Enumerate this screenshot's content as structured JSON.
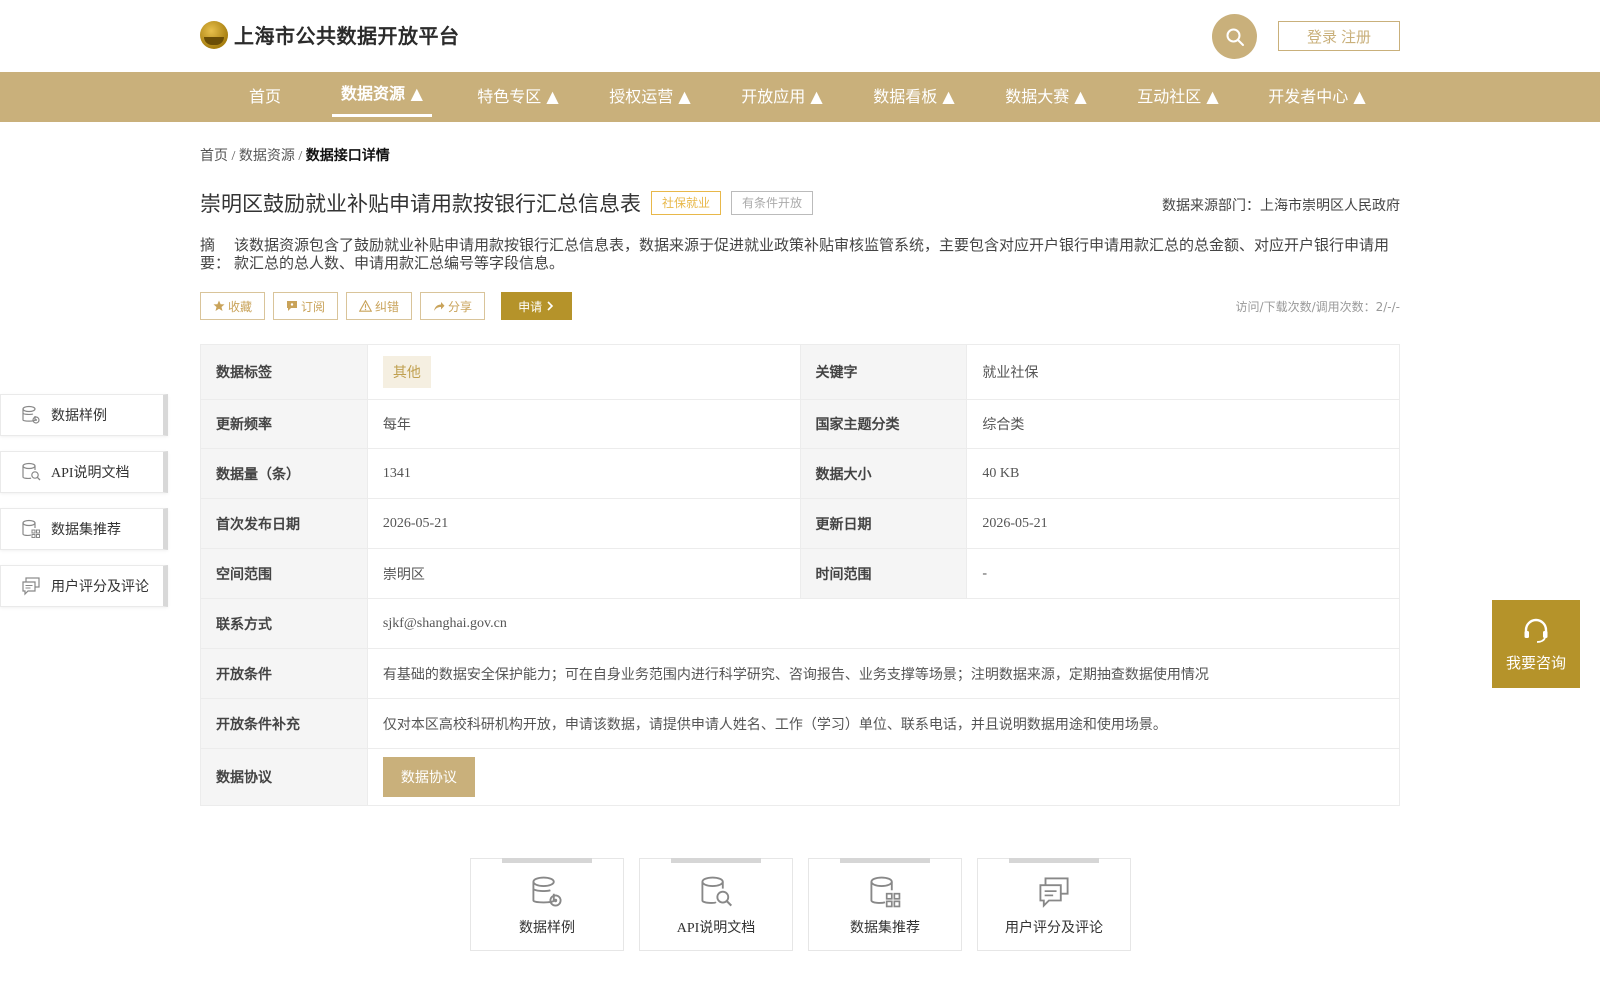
{
  "header": {
    "logo_text": "上海市公共数据开放平台",
    "login_label": "登录",
    "register_label": "注册"
  },
  "nav": {
    "items": [
      {
        "label": "首页"
      },
      {
        "label": "数据资源 ▲"
      },
      {
        "label": "特色专区 ▲"
      },
      {
        "label": "授权运营 ▲"
      },
      {
        "label": "开放应用 ▲"
      },
      {
        "label": "数据看板 ▲"
      },
      {
        "label": "数据大赛 ▲"
      },
      {
        "label": "互动社区 ▲"
      },
      {
        "label": "开发者中心 ▲"
      }
    ],
    "active_index": 1
  },
  "breadcrumb": {
    "home": "首页",
    "sep1": "/",
    "section": "数据资源",
    "sep2": "/",
    "current": "数据接口详情"
  },
  "dataset": {
    "title": "崇明区鼓励就业补贴申请用款按银行汇总信息表",
    "tag_category": "社保就业",
    "tag_open": "有条件开放",
    "source": "数据来源部门：上海市崇明区人民政府",
    "abstract_label": "摘要：",
    "abstract_text": "该数据资源包含了鼓励就业补贴申请用款按银行汇总信息表，数据来源于促进就业政策补贴审核监管系统，主要包含对应开户银行申请用款汇总的总金额、对应开户银行申请用款汇总的总人数、申请用款汇总编号等字段信息。",
    "stats": "访问/下载次数/调用次数：2/-/-"
  },
  "actions": {
    "favorite": "收藏",
    "subscribe": "订阅",
    "report": "纠错",
    "share": "分享",
    "apply": "申请"
  },
  "info": {
    "tag_label": "数据标签",
    "tag_value": "其他",
    "keyword_label": "关键字",
    "keyword_value": "就业社保",
    "freq_label": "更新频率",
    "freq_value": "每年",
    "theme_label": "国家主题分类",
    "theme_value": "综合类",
    "count_label": "数据量（条）",
    "count_value": "1341",
    "size_label": "数据大小",
    "size_value": "40 KB",
    "first_date_label": "首次发布日期",
    "first_date_value": "2026-05-21",
    "update_date_label": "更新日期",
    "update_date_value": "2026-05-21",
    "space_label": "空间范围",
    "space_value": "崇明区",
    "time_label": "时间范围",
    "time_value": "-",
    "contact_label": "联系方式",
    "contact_value": "sjkf@shanghai.gov.cn",
    "cond_label": "开放条件",
    "cond_value": "有基础的数据安全保护能力；可在自身业务范围内进行科学研究、咨询报告、业务支撑等场景；注明数据来源，定期抽查数据使用情况",
    "cond_extra_label": "开放条件补充",
    "cond_extra_value": "仅对本区高校科研机构开放，申请该数据，请提供申请人姓名、工作（学习）单位、联系电话，并且说明数据用途和使用场景。",
    "protocol_label": "数据协议",
    "protocol_button": "数据协议"
  },
  "side_menu": [
    {
      "label": "数据样例",
      "icon": "database-gear-icon"
    },
    {
      "label": "API说明文档",
      "icon": "database-search-icon"
    },
    {
      "label": "数据集推荐",
      "icon": "database-grid-icon"
    },
    {
      "label": "用户评分及评论",
      "icon": "comment-icon"
    }
  ],
  "consult": {
    "label": "我要咨询"
  },
  "bottom_cards": [
    {
      "label": "数据样例"
    },
    {
      "label": "API说明文档"
    },
    {
      "label": "数据集推荐"
    },
    {
      "label": "用户评分及评论"
    }
  ],
  "colors": {
    "accent": "#c9b07b",
    "apply": "#b5932a",
    "tag_gold": "#e8b84a"
  }
}
